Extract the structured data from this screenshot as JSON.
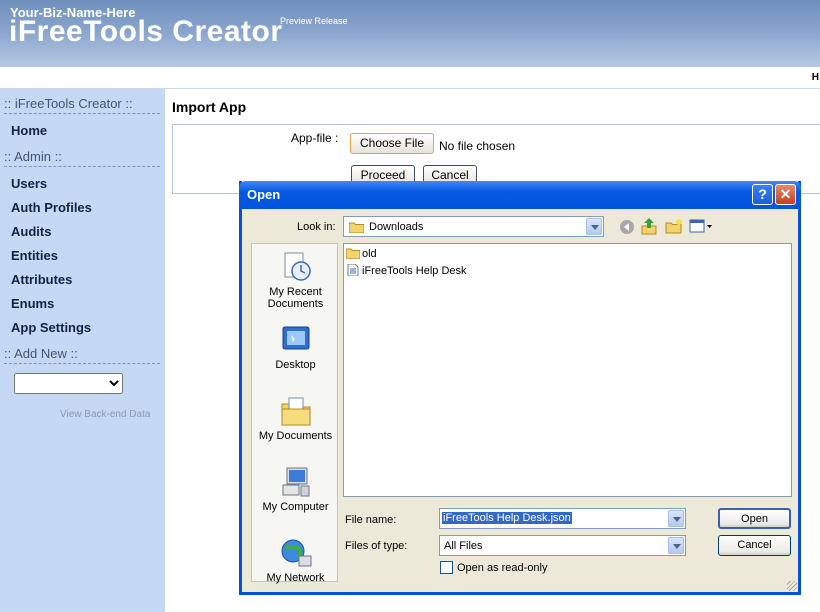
{
  "header": {
    "biz_name": "Your-Biz-Name-Here",
    "app_name": "iFreeTools Creator",
    "release": "Preview Release",
    "help_letter": "H"
  },
  "sidebar": {
    "section_main": ":: iFreeTools Creator ::",
    "home": "Home",
    "section_admin": ":: Admin ::",
    "admin_items": [
      "Users",
      "Auth Profiles",
      "Audits",
      "Entities",
      "Attributes",
      "Enums",
      "App Settings"
    ],
    "section_add": ":: Add New ::",
    "add_new_value": "",
    "view_backend": "View Back-end Data"
  },
  "main": {
    "title": "Import App",
    "app_file_label": "App-file :",
    "choose_file": "Choose File",
    "no_file": "No file chosen",
    "proceed": "Proceed",
    "cancel": "Cancel"
  },
  "dialog": {
    "title": "Open",
    "help_btn": "?",
    "close_btn": "X",
    "look_in_label": "Look in:",
    "look_in_value": "Downloads",
    "places": [
      "My Recent Documents",
      "Desktop",
      "My Documents",
      "My Computer",
      "My Network"
    ],
    "files": [
      {
        "name": "old",
        "icon": "folder-icon"
      },
      {
        "name": "iFreeTools Help Desk",
        "icon": "document-icon"
      }
    ],
    "file_name_label": "File name:",
    "file_name_value": "iFreeTools Help Desk.json",
    "file_type_label": "Files of type:",
    "file_type_value": "All Files",
    "read_only_label": "Open as read-only",
    "open_btn": "Open",
    "cancel_btn": "Cancel"
  },
  "colors": {
    "header_blue": "#6f8fbd",
    "sidebar": "#c6d9f4",
    "xp_title": "#0458e0",
    "xp_face": "#ece9d8"
  }
}
